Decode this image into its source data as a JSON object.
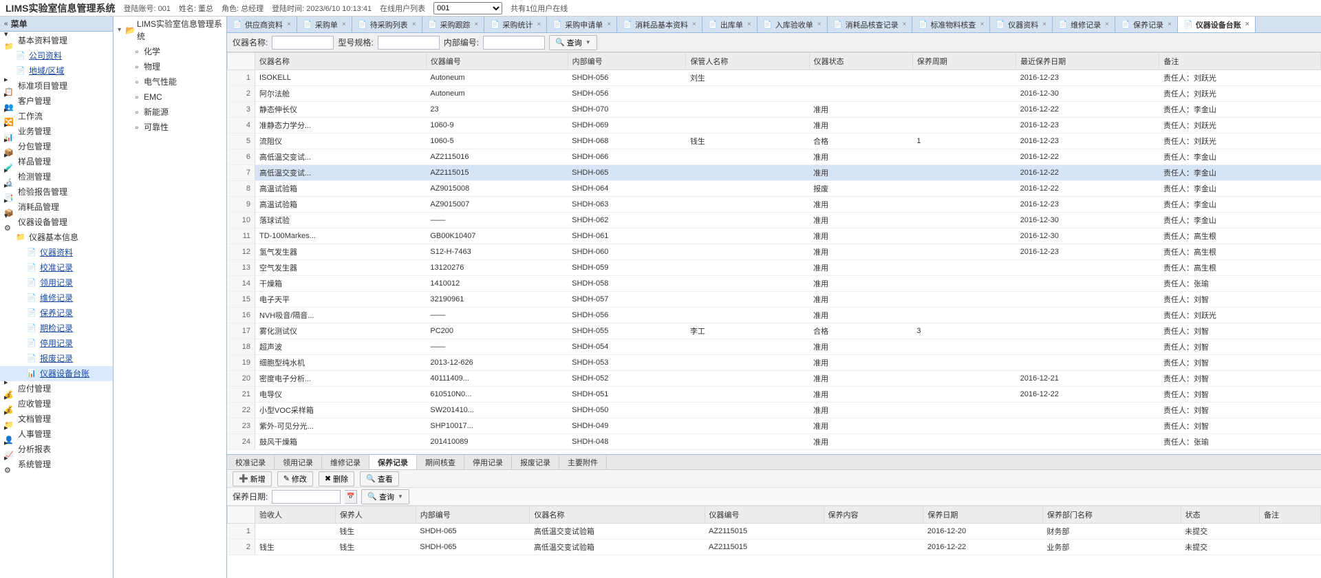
{
  "header": {
    "title": "LIMS实验室信息管理系统",
    "account_label": "登陆账号: 001",
    "name_label": "姓名: 董总",
    "role_label": "角色: 总经理",
    "login_time_label": "登陆时间: 2023/6/10 10:13:41",
    "online_label": "在线用户列表",
    "online_select": "001",
    "online_count": "共有1位用户在线"
  },
  "menu_title": "菜单",
  "menu": [
    {
      "label": "基本资料管理",
      "icon": "📁",
      "level": 0,
      "expand": true
    },
    {
      "label": "公司资料",
      "icon": "📄",
      "level": 1,
      "link": true
    },
    {
      "label": "地域/区域",
      "icon": "📄",
      "level": 1,
      "link": true
    },
    {
      "label": "标准项目管理",
      "icon": "📋",
      "level": 0
    },
    {
      "label": "客户管理",
      "icon": "👥",
      "level": 0
    },
    {
      "label": "工作流",
      "icon": "🔀",
      "level": 0
    },
    {
      "label": "业务管理",
      "icon": "📊",
      "level": 0
    },
    {
      "label": "分包管理",
      "icon": "📦",
      "level": 0
    },
    {
      "label": "样品管理",
      "icon": "🧪",
      "level": 0
    },
    {
      "label": "检测管理",
      "icon": "🔬",
      "level": 0
    },
    {
      "label": "检验报告管理",
      "icon": "📑",
      "level": 0
    },
    {
      "label": "消耗品管理",
      "icon": "📦",
      "level": 0
    },
    {
      "label": "仪器设备管理",
      "icon": "⚙",
      "level": 0,
      "expand": true
    },
    {
      "label": "仪器基本信息",
      "icon": "📁",
      "level": 1
    },
    {
      "label": "仪器资料",
      "icon": "📄",
      "level": 2,
      "link": true
    },
    {
      "label": "校准记录",
      "icon": "📄",
      "level": 2,
      "link": true
    },
    {
      "label": "领用记录",
      "icon": "📄",
      "level": 2,
      "link": true
    },
    {
      "label": "维修记录",
      "icon": "📄",
      "level": 2,
      "link": true
    },
    {
      "label": "保养记录",
      "icon": "📄",
      "level": 2,
      "link": true
    },
    {
      "label": "期检记录",
      "icon": "📄",
      "level": 2,
      "link": true
    },
    {
      "label": "停用记录",
      "icon": "📄",
      "level": 2,
      "link": true
    },
    {
      "label": "报废记录",
      "icon": "📄",
      "level": 2,
      "link": true
    },
    {
      "label": "仪器设备台账",
      "icon": "📊",
      "level": 2,
      "link": true,
      "selected": true
    },
    {
      "label": "应付管理",
      "icon": "💰",
      "level": 0
    },
    {
      "label": "应收管理",
      "icon": "💰",
      "level": 0
    },
    {
      "label": "文档管理",
      "icon": "📁",
      "level": 0
    },
    {
      "label": "人事管理",
      "icon": "👤",
      "level": 0
    },
    {
      "label": "分析报表",
      "icon": "📈",
      "level": 0
    },
    {
      "label": "系统管理",
      "icon": "⚙",
      "level": 0
    }
  ],
  "tree": {
    "root": "LIMS实验室信息管理系统",
    "children": [
      "化学",
      "物理",
      "电气性能",
      "EMC",
      "新能源",
      "可靠性"
    ]
  },
  "tabs": [
    {
      "label": "供应商资料"
    },
    {
      "label": "采购单"
    },
    {
      "label": "待采购列表"
    },
    {
      "label": "采购跟踪"
    },
    {
      "label": "采购统计"
    },
    {
      "label": "采购申请单"
    },
    {
      "label": "消耗品基本资料"
    },
    {
      "label": "出库单"
    },
    {
      "label": "入库验收单"
    },
    {
      "label": "消耗品核查记录"
    },
    {
      "label": "标准物料核查"
    },
    {
      "label": "仪器资料"
    },
    {
      "label": "维修记录"
    },
    {
      "label": "保养记录"
    },
    {
      "label": "仪器设备台账",
      "active": true
    }
  ],
  "search": {
    "name_label": "仪器名称:",
    "spec_label": "型号规格:",
    "code_label": "内部编号:",
    "query_btn": "查询"
  },
  "grid": {
    "columns": [
      "仪器名称",
      "仪器编号",
      "内部编号",
      "保管人名称",
      "仪器状态",
      "保养周期",
      "最近保养日期",
      "备注"
    ],
    "rows": [
      [
        "ISOKELL",
        "Autoneum",
        "SHDH-056",
        "刘生",
        "",
        "",
        "2016-12-23",
        "责任人：刘跃光"
      ],
      [
        "阿尔法舱",
        "Autoneum",
        "SHDH-056",
        "",
        "",
        "",
        "2016-12-30",
        "责任人：刘跃光"
      ],
      [
        "静态伸长仪",
        "23",
        "SHDH-070",
        "",
        "准用",
        "",
        "2016-12-22",
        "责任人：李金山"
      ],
      [
        "准静态力学分...",
        "1060-9",
        "SHDH-069",
        "",
        "准用",
        "",
        "2016-12-23",
        "责任人：刘跃光"
      ],
      [
        "流阻仪",
        "1060-5",
        "SHDH-068",
        "钱生",
        "合格",
        "1",
        "2016-12-23",
        "责任人：刘跃光"
      ],
      [
        "高低温交变试...",
        "AZ2115016",
        "SHDH-066",
        "",
        "准用",
        "",
        "2016-12-22",
        "责任人：李金山"
      ],
      [
        "高低温交变试...",
        "AZ2115015",
        "SHDH-065",
        "",
        "准用",
        "",
        "2016-12-22",
        "责任人：李金山"
      ],
      [
        "高温试验箱",
        "AZ9015008",
        "SHDH-064",
        "",
        "报废",
        "",
        "2016-12-22",
        "责任人：李金山"
      ],
      [
        "高温试验箱",
        "AZ9015007",
        "SHDH-063",
        "",
        "准用",
        "",
        "2016-12-23",
        "责任人：李金山"
      ],
      [
        "落球试验",
        "——",
        "SHDH-062",
        "",
        "准用",
        "",
        "2016-12-30",
        "责任人：李金山"
      ],
      [
        "TD-100Markes...",
        "GB00K10407",
        "SHDH-061",
        "",
        "准用",
        "",
        "2016-12-30",
        "责任人：高生根"
      ],
      [
        "氢气发生器",
        "S12-H-7463",
        "SHDH-060",
        "",
        "准用",
        "",
        "2016-12-23",
        "责任人：高生根"
      ],
      [
        "空气发生器",
        "13120276",
        "SHDH-059",
        "",
        "准用",
        "",
        "",
        "责任人：高生根"
      ],
      [
        "干燥箱",
        "1410012",
        "SHDH-058",
        "",
        "准用",
        "",
        "",
        "责任人：张瑜"
      ],
      [
        "电子天平",
        "32190961",
        "SHDH-057",
        "",
        "准用",
        "",
        "",
        "责任人：刘智"
      ],
      [
        "NVH吸音/隔音...",
        "——",
        "SHDH-056",
        "",
        "准用",
        "",
        "",
        "责任人：刘跃光"
      ],
      [
        "雾化测试仪",
        "PC200",
        "SHDH-055",
        "李工",
        "合格",
        "3",
        "",
        "责任人：刘智"
      ],
      [
        "超声波",
        "——",
        "SHDH-054",
        "",
        "准用",
        "",
        "",
        "责任人：刘智"
      ],
      [
        "细胞型纯水机",
        "2013-12-626",
        "SHDH-053",
        "",
        "准用",
        "",
        "",
        "责任人：刘智"
      ],
      [
        "密度电子分析...",
        "40111409...",
        "SHDH-052",
        "",
        "准用",
        "",
        "2016-12-21",
        "责任人：刘智"
      ],
      [
        "电导仪",
        "610510N0...",
        "SHDH-051",
        "",
        "准用",
        "",
        "2016-12-22",
        "责任人：刘智"
      ],
      [
        "小型VOC采样箱",
        "SW201410...",
        "SHDH-050",
        "",
        "准用",
        "",
        "",
        "责任人：刘智"
      ],
      [
        "紫外-可见分光...",
        "SHP10017...",
        "SHDH-049",
        "",
        "准用",
        "",
        "",
        "责任人：刘智"
      ],
      [
        "鼓风干燥箱",
        "201410089",
        "SHDH-048",
        "",
        "准用",
        "",
        "",
        "责任人：张瑜"
      ]
    ],
    "selected_row": 7
  },
  "detail": {
    "tabs": [
      "校准记录",
      "领用记录",
      "维修记录",
      "保养记录",
      "期间核查",
      "停用记录",
      "报废记录",
      "主要附件"
    ],
    "active_tab": 3,
    "toolbar": {
      "add": "新增",
      "edit": "修改",
      "delete": "删除",
      "view": "查看"
    },
    "date_label": "保养日期:",
    "query_btn": "查询",
    "columns": [
      "验收人",
      "保养人",
      "内部编号",
      "仪器名称",
      "仪器编号",
      "保养内容",
      "保养日期",
      "保养部门名称",
      "状态",
      "备注"
    ],
    "rows": [
      [
        "",
        "钱生",
        "SHDH-065",
        "高低温交变试验箱",
        "AZ2115015",
        "",
        "2016-12-20",
        "财务部",
        "未提交",
        ""
      ],
      [
        "钱生",
        "钱生",
        "SHDH-065",
        "高低温交变试验箱",
        "AZ2115015",
        "",
        "2016-12-22",
        "业务部",
        "未提交",
        ""
      ]
    ]
  }
}
